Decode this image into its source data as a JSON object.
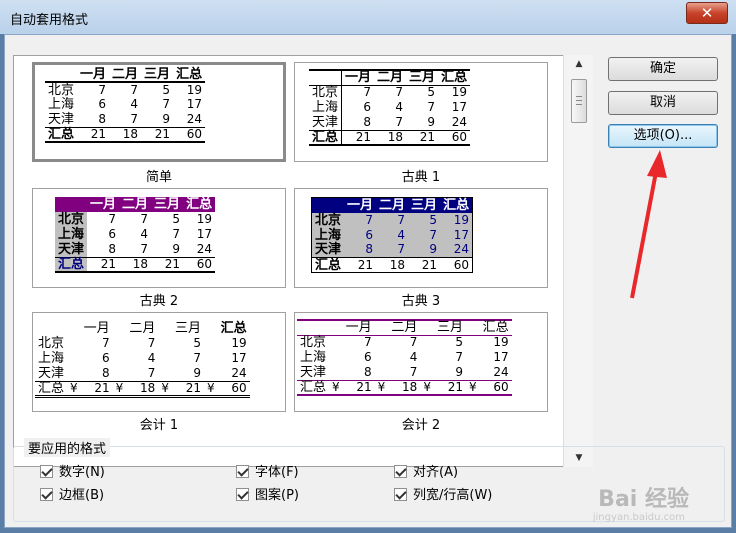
{
  "window": {
    "title": "自动套用格式",
    "close_glyph": "✕"
  },
  "buttons": {
    "ok": "确定",
    "cancel": "取消",
    "options": "选项(O)..."
  },
  "group": {
    "title": "要应用的格式",
    "items": [
      {
        "label": "数字(N)",
        "checked": true
      },
      {
        "label": "字体(F)",
        "checked": true
      },
      {
        "label": "对齐(A)",
        "checked": true
      },
      {
        "label": "边框(B)",
        "checked": true
      },
      {
        "label": "图案(P)",
        "checked": true
      },
      {
        "label": "列宽/行高(W)",
        "checked": true
      }
    ]
  },
  "sample": {
    "header": [
      "一月",
      "二月",
      "三月",
      "汇总"
    ],
    "rows": [
      [
        "北京",
        "7",
        "7",
        "5",
        "19"
      ],
      [
        "上海",
        "6",
        "4",
        "7",
        "17"
      ],
      [
        "天津",
        "8",
        "7",
        "9",
        "24"
      ],
      [
        "汇总",
        "21",
        "18",
        "21",
        "60"
      ]
    ],
    "currency": "¥"
  },
  "formats": [
    "简单",
    "古典 1",
    "古典 2",
    "古典 3",
    "会计 1",
    "会计 2"
  ],
  "scrollbar": {
    "up": "▲",
    "down": "▼"
  },
  "watermark": {
    "brand": "Bai 经验",
    "url": "jingyan.baidu.com"
  },
  "colors": {
    "purple": "#800080",
    "navy": "#000080",
    "gray": "#c0c0c0",
    "arrow": "#e8282a"
  }
}
